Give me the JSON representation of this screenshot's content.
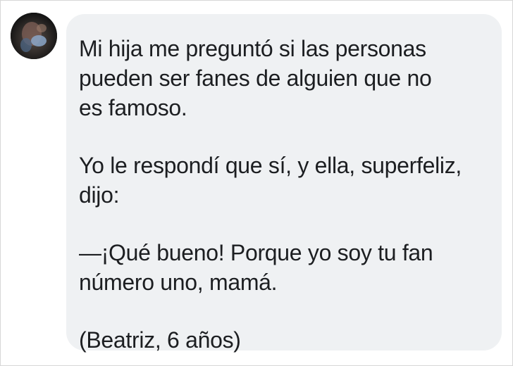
{
  "comment": {
    "avatar_icon": "user-photo-blurred",
    "paragraphs": [
      "Mi hija me preguntó si las personas\npueden ser fanes de alguien que no\nes famoso.",
      "Yo le respondí que sí, y ella, superfeliz,\ndijo:",
      "—¡Qué bueno! Porque yo soy tu fan\nnúmero uno, mamá.",
      "(Beatriz, 6 años)"
    ]
  },
  "colors": {
    "bubble_background": "#eff1f3",
    "text": "#1c1e21"
  }
}
